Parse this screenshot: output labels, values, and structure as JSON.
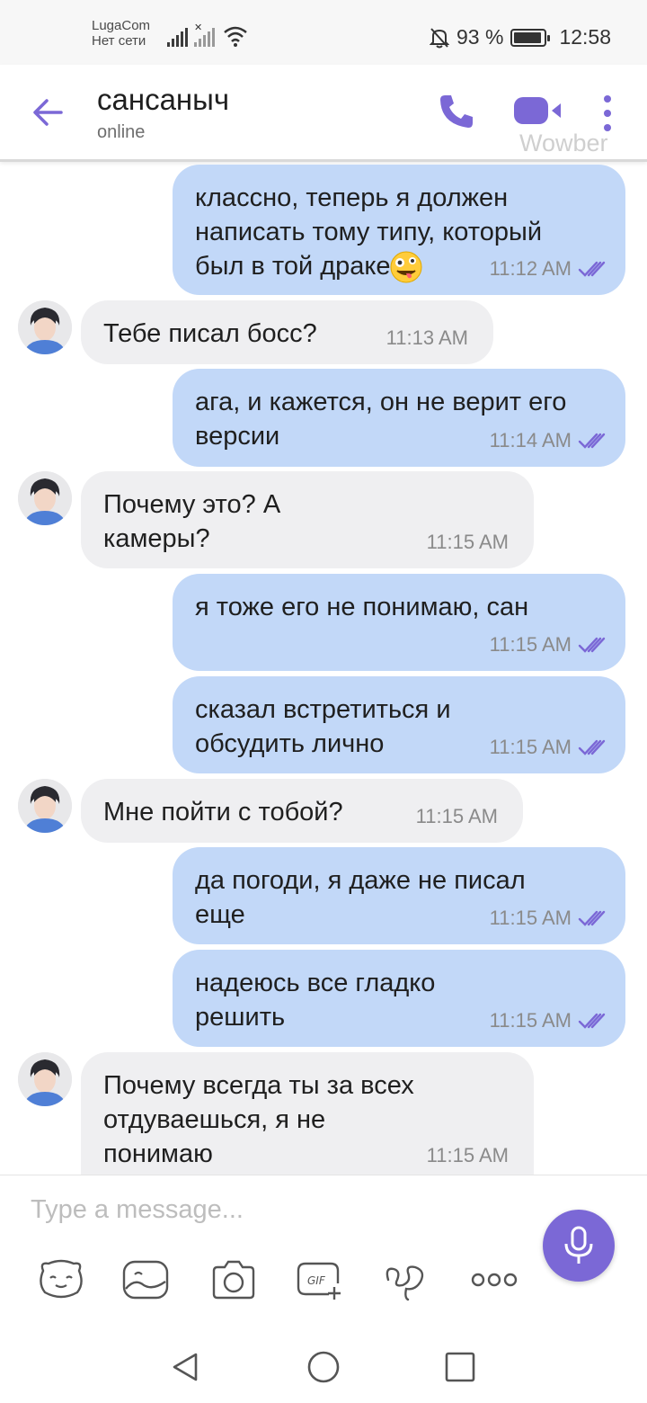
{
  "status_bar": {
    "carrier": "LugaCom",
    "network": "Нет сети",
    "battery": "93 %",
    "battery_level": 0.93,
    "time": "12:58"
  },
  "header": {
    "contact_name": "сансаныч",
    "contact_status": "online",
    "watermark": "Wowber"
  },
  "messages": [
    {
      "direction": "out",
      "text": "классно, теперь я должен написать тому типу, который был в той драке",
      "emoji": "zany-face",
      "time": "11:12 AM",
      "read": true
    },
    {
      "direction": "in",
      "text": "Тебе писал босс?",
      "time": "11:13 AM"
    },
    {
      "direction": "out",
      "text": "ага, и кажется, он не верит его версии",
      "time": "11:14 AM",
      "read": true
    },
    {
      "direction": "in",
      "text": "Почему это? А камеры?",
      "time": "11:15 AM"
    },
    {
      "direction": "out",
      "text": "я тоже его не понимаю, сан",
      "time": "11:15 AM",
      "read": true
    },
    {
      "direction": "out",
      "text": "сказал встретиться и обсудить лично",
      "time": "11:15 AM",
      "read": true
    },
    {
      "direction": "in",
      "text": "Мне пойти с тобой?",
      "time": "11:15 AM"
    },
    {
      "direction": "out",
      "text": "да погоди, я даже не писал еще",
      "time": "11:15 AM",
      "read": true
    },
    {
      "direction": "out",
      "text": "надеюсь все гладко решить",
      "time": "11:15 AM",
      "read": true
    },
    {
      "direction": "in",
      "text": "Почему всегда ты за всех отдуваешься, я не понимаю",
      "time": "11:15 AM"
    }
  ],
  "composer": {
    "placeholder": "Type a message...",
    "tools": [
      "sticker-icon",
      "gallery-icon",
      "camera-icon",
      "gif-icon",
      "doodle-icon",
      "more-icon"
    ]
  },
  "colors": {
    "accent": "#7b68d6",
    "outgoing_bubble": "#c2d8f8",
    "incoming_bubble": "#efeff1"
  }
}
